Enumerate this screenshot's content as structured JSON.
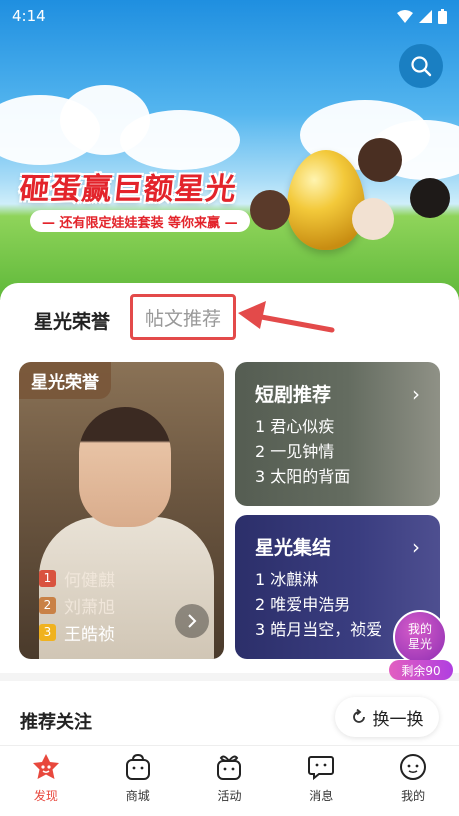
{
  "status_bar": {
    "time": "4:14"
  },
  "banner": {
    "title": "砸蛋赢巨额星光",
    "subtitle": "— 还有限定娃娃套装 等你来赢 —"
  },
  "tabs": [
    {
      "label": "星光荣誉",
      "active": true
    },
    {
      "label": "帖文推荐",
      "active": false
    }
  ],
  "honor_card": {
    "tag": "星光荣誉",
    "ranking": [
      {
        "rank": "1",
        "name": "何健麒",
        "color": "#d9533f"
      },
      {
        "rank": "2",
        "name": "刘萧旭",
        "color": "#c98146"
      },
      {
        "rank": "3",
        "name": "王皓祯",
        "color": "#f0b21f"
      }
    ]
  },
  "drama_card": {
    "title": "短剧推荐",
    "items": [
      "1 君心似疾",
      "2 一见钟情",
      "3 太阳的背面"
    ]
  },
  "gather_card": {
    "title": "星光集结",
    "items": [
      "1 冰麒淋",
      "2 唯爱申浩男",
      "3 皓月当空，祯爱"
    ]
  },
  "star_badge": {
    "line1": "我的",
    "line2": "星光",
    "remaining": "剩余90"
  },
  "recommend": {
    "title": "推荐关注",
    "refresh_label": "换一换"
  },
  "nav": [
    {
      "label": "发现",
      "icon": "discover-icon",
      "active": true
    },
    {
      "label": "商城",
      "icon": "shop-icon",
      "active": false
    },
    {
      "label": "活动",
      "icon": "activity-icon",
      "active": false
    },
    {
      "label": "消息",
      "icon": "message-icon",
      "active": false
    },
    {
      "label": "我的",
      "icon": "profile-icon",
      "active": false
    }
  ],
  "colors": {
    "accent": "#e8483d",
    "highlight_border": "#e34a4a"
  }
}
